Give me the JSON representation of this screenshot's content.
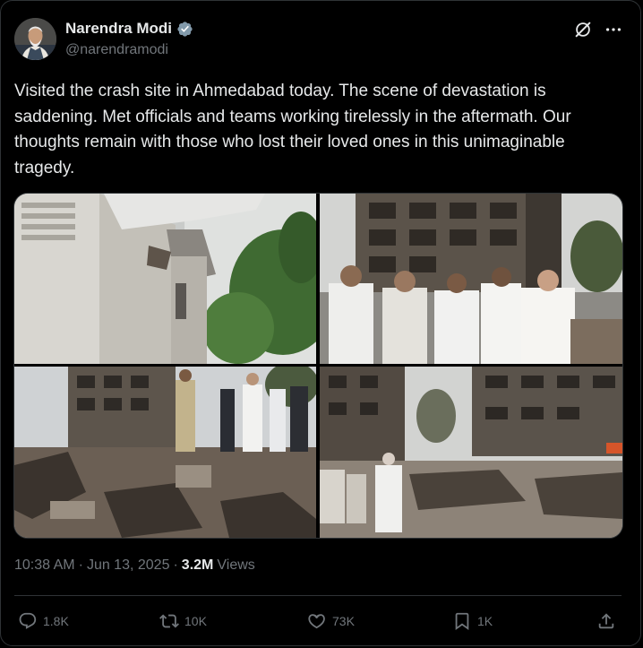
{
  "author": {
    "display_name": "Narendra Modi",
    "handle": "@narendramodi",
    "verified": true,
    "avatar_icon": "profile-photo"
  },
  "tweet": {
    "text": "Visited the crash site in Ahmedabad today. The scene of devastation is saddening. Met officials and teams working tirelessly in the aftermath. Our thoughts remain with those who lost their loved ones in this unimaginable tragedy."
  },
  "meta": {
    "time": "10:38 AM",
    "separator": "·",
    "date": "Jun 13, 2025",
    "views_count": "3.2M",
    "views_label": "Views"
  },
  "actions": {
    "replies": "1.8K",
    "reposts": "10K",
    "likes": "73K",
    "bookmarks": "1K"
  },
  "colors": {
    "background": "#000000",
    "text": "#e7e9ea",
    "muted": "#71767b",
    "border": "#2f3336",
    "verified": "#829aab"
  },
  "icons": [
    "verified-badge-icon",
    "grok-icon",
    "more-icon",
    "reply-icon",
    "repost-icon",
    "like-icon",
    "bookmark-icon",
    "share-icon"
  ]
}
